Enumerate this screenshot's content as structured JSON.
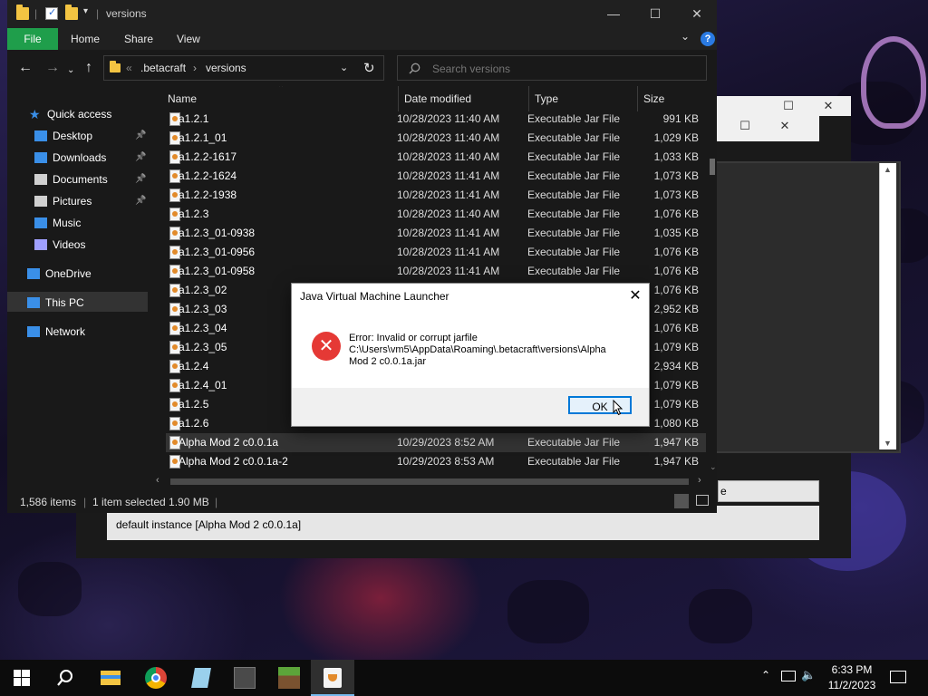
{
  "explorer": {
    "title": "versions",
    "ribbon": {
      "file": "File",
      "home": "Home",
      "share": "Share",
      "view": "View",
      "help": "?"
    },
    "address": {
      "parent": ".betacraft",
      "current": "versions",
      "sep": "›",
      "more": "«"
    },
    "search_placeholder": "Search versions",
    "sidebar": [
      {
        "label": "Quick access",
        "icon": "star-icon",
        "color": "#3a8fe8"
      },
      {
        "label": "Desktop",
        "icon": "desktop-icon",
        "color": "#3a8fe8",
        "pinned": true
      },
      {
        "label": "Downloads",
        "icon": "download-icon",
        "color": "#3a8fe8",
        "pinned": true
      },
      {
        "label": "Documents",
        "icon": "document-icon",
        "color": "#d0d0d0",
        "pinned": true
      },
      {
        "label": "Pictures",
        "icon": "pictures-icon",
        "color": "#d0d0d0",
        "pinned": true
      },
      {
        "label": "Music",
        "icon": "music-icon",
        "color": "#3a8fe8"
      },
      {
        "label": "Videos",
        "icon": "video-icon",
        "color": "#a0a0ff"
      },
      {
        "label": "OneDrive",
        "icon": "cloud-icon",
        "color": "#3a8fe8"
      },
      {
        "label": "This PC",
        "icon": "computer-icon",
        "color": "#3a8fe8"
      },
      {
        "label": "Network",
        "icon": "network-icon",
        "color": "#3a8fe8"
      }
    ],
    "columns": {
      "name": "Name",
      "date": "Date modified",
      "type": "Type",
      "size": "Size"
    },
    "files": [
      {
        "name": "a1.2.1",
        "date": "10/28/2023 11:40 AM",
        "type": "Executable Jar File",
        "size": "991 KB"
      },
      {
        "name": "a1.2.1_01",
        "date": "10/28/2023 11:40 AM",
        "type": "Executable Jar File",
        "size": "1,029 KB"
      },
      {
        "name": "a1.2.2-1617",
        "date": "10/28/2023 11:40 AM",
        "type": "Executable Jar File",
        "size": "1,033 KB"
      },
      {
        "name": "a1.2.2-1624",
        "date": "10/28/2023 11:41 AM",
        "type": "Executable Jar File",
        "size": "1,073 KB"
      },
      {
        "name": "a1.2.2-1938",
        "date": "10/28/2023 11:41 AM",
        "type": "Executable Jar File",
        "size": "1,073 KB"
      },
      {
        "name": "a1.2.3",
        "date": "10/28/2023 11:40 AM",
        "type": "Executable Jar File",
        "size": "1,076 KB"
      },
      {
        "name": "a1.2.3_01-0938",
        "date": "10/28/2023 11:41 AM",
        "type": "Executable Jar File",
        "size": "1,035 KB"
      },
      {
        "name": "a1.2.3_01-0956",
        "date": "10/28/2023 11:41 AM",
        "type": "Executable Jar File",
        "size": "1,076 KB"
      },
      {
        "name": "a1.2.3_01-0958",
        "date": "10/28/2023 11:41 AM",
        "type": "Executable Jar File",
        "size": "1,076 KB"
      },
      {
        "name": "a1.2.3_02",
        "date": "",
        "type": "",
        "size": "1,076 KB"
      },
      {
        "name": "a1.2.3_03",
        "date": "",
        "type": "",
        "size": "2,952 KB"
      },
      {
        "name": "a1.2.3_04",
        "date": "",
        "type": "",
        "size": "1,076 KB"
      },
      {
        "name": "a1.2.3_05",
        "date": "",
        "type": "",
        "size": "1,079 KB"
      },
      {
        "name": "a1.2.4",
        "date": "",
        "type": "",
        "size": "2,934 KB"
      },
      {
        "name": "a1.2.4_01",
        "date": "",
        "type": "",
        "size": "1,079 KB"
      },
      {
        "name": "a1.2.5",
        "date": "",
        "type": "",
        "size": "1,079 KB"
      },
      {
        "name": "a1.2.6",
        "date": "",
        "type": "",
        "size": "1,080 KB"
      },
      {
        "name": "Alpha Mod 2 c0.0.1a",
        "date": "10/29/2023 8:52 AM",
        "type": "Executable Jar File",
        "size": "1,947 KB",
        "selected": true
      },
      {
        "name": "Alpha Mod 2 c0.0.1a-2",
        "date": "10/29/2023 8:53 AM",
        "type": "Executable Jar File",
        "size": "1,947 KB"
      }
    ],
    "status": {
      "items": "1,586 items",
      "selected": "1 item selected  1.90 MB"
    }
  },
  "launcher": {
    "instance": "default instance [Alpha Mod 2 c0.0.1a]",
    "button_partial": "e"
  },
  "dialog": {
    "title": "Java Virtual Machine Launcher",
    "message_line1": "Error: Invalid or corrupt jarfile",
    "message_line2": "C:\\Users\\vm5\\AppData\\Roaming\\.betacraft\\versions\\Alpha",
    "message_line3": "Mod 2 c0.0.1a.jar",
    "ok": "OK"
  },
  "taskbar": {
    "apps": [
      "start-icon",
      "search-icon",
      "file-explorer-icon",
      "chrome-icon",
      "notepad-icon",
      "minecraft-launcher-icon",
      "minecraft-icon",
      "java-icon"
    ],
    "time": "6:33 PM",
    "date": "11/2/2023"
  }
}
